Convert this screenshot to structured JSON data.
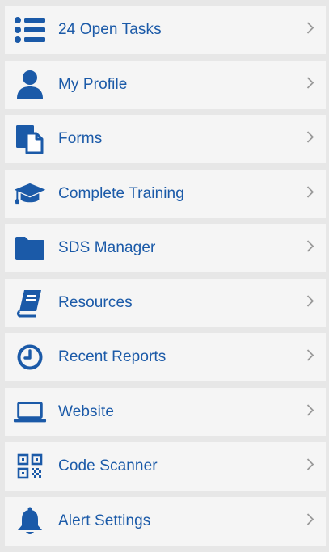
{
  "theme": {
    "accent": "#1b5aa8",
    "row_bg": "#f5f5f5",
    "page_bg": "#e7e7e7",
    "chevron": "#9a9a9a"
  },
  "menu": {
    "items": [
      {
        "label": "24 Open Tasks",
        "icon": "list-icon"
      },
      {
        "label": "My Profile",
        "icon": "user-icon"
      },
      {
        "label": "Forms",
        "icon": "forms-icon"
      },
      {
        "label": "Complete Training",
        "icon": "graduation-cap-icon"
      },
      {
        "label": "SDS Manager",
        "icon": "folder-icon"
      },
      {
        "label": "Resources",
        "icon": "book-icon"
      },
      {
        "label": "Recent Reports",
        "icon": "clock-icon"
      },
      {
        "label": "Website",
        "icon": "laptop-icon"
      },
      {
        "label": "Code Scanner",
        "icon": "qr-code-icon"
      },
      {
        "label": "Alert Settings",
        "icon": "bell-icon"
      }
    ]
  }
}
